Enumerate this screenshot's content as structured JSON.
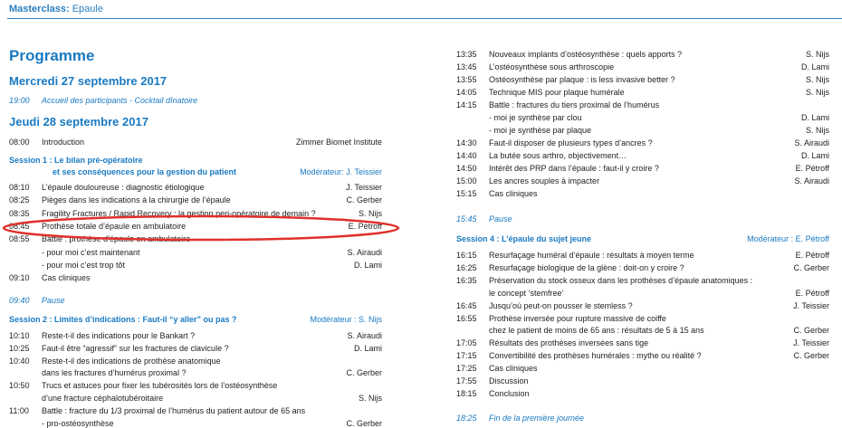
{
  "header": {
    "prefix": "Masterclass:",
    "topic": "Epaule"
  },
  "title": "Programme",
  "left": {
    "day1": "Mercredi 27 septembre 2017",
    "day1_time": "19:00",
    "day1_event": "Accueil des participants - Cocktail dînatoire",
    "day2": "Jeudi 28 septembre 2017",
    "intro": {
      "time": "08:00",
      "title": "Introduction",
      "speaker": "Zimmer Biomet Institute"
    },
    "session1_line1": "Session 1 : Le bilan pré-opératoire",
    "session1_line2": "et ses conséquences pour la gestion du patient",
    "session1_mod": "Modérateur: J. Teissier",
    "s1": [
      {
        "time": "08:10",
        "title": "L’épaule douloureuse : diagnostic étiologique",
        "speaker": "J. Teissier"
      },
      {
        "time": "08:25",
        "title": "Pièges dans les indications à la chirurgie de l’épaule",
        "speaker": "C. Gerber"
      },
      {
        "time": "08:35",
        "title": "Fragility Fractures / Rapid Recovery : la gestion peri-opératoire de demain ?",
        "speaker": "S. Nijs"
      },
      {
        "time": "08:45",
        "title": "Prothèse totale d’épaule en ambulatoire",
        "speaker": "E. Pétroff"
      },
      {
        "time": "08:55",
        "title": "Battle : prothèse d’épaule en ambulatoire",
        "speaker": ""
      },
      {
        "time": "",
        "title": "- pour moi c’est maintenant",
        "speaker": "S. Airaudi"
      },
      {
        "time": "",
        "title": "- pour moi c’est trop tôt",
        "speaker": "D. Lami"
      },
      {
        "time": "09:10",
        "title": "Cas cliniques",
        "speaker": ""
      }
    ],
    "pause_time": "09:40",
    "pause_label": "Pause",
    "session2": "Session 2 : Limites d’indications : Faut-il “y aller” ou pas ?",
    "session2_mod": "Modérateur : S. Nijs",
    "s2": [
      {
        "time": "10:10",
        "title": "Reste-t-il des indications pour le Bankart ?",
        "speaker": "S. Airaudi"
      },
      {
        "time": "10:25",
        "title": "Faut-il être “agressif” sur les fractures de clavicule ?",
        "speaker": "D. Lami"
      },
      {
        "time": "10:40",
        "title": "Reste-t-il des indications de prothèse anatomique",
        "speaker": ""
      },
      {
        "time": "",
        "title": "dans les fractures d’humérus proximal ?",
        "speaker": "C. Gerber"
      },
      {
        "time": "10:50",
        "title": "Trucs et astuces pour fixer les tubérosités lors de l’ostéosynthèse",
        "speaker": ""
      },
      {
        "time": "",
        "title": "d’une fracture céphalotubéroitaire",
        "speaker": "S. Nijs"
      },
      {
        "time": "11:00",
        "title": "Battle : fracture du 1/3 proximal de l’humérus du patient autour de 65 ans",
        "speaker": ""
      },
      {
        "time": "",
        "title": "- pro-ostéosynthèse",
        "speaker": "C. Gerber"
      }
    ]
  },
  "right": {
    "r1": [
      {
        "time": "13:35",
        "title": "Nouveaux implants d’ostéosynthèse : quels apports ?",
        "speaker": "S. Nijs"
      },
      {
        "time": "13:45",
        "title": "L’ostéosynthèse sous arthroscopie",
        "speaker": "D. Lami"
      },
      {
        "time": "13:55",
        "title": "Ostéosynthèse par plaque : is less invasive better ?",
        "speaker": "S. Nijs"
      },
      {
        "time": "14:05",
        "title": "Technique MIS pour plaque humérale",
        "speaker": "S. Nijs"
      },
      {
        "time": "14:15",
        "title": "Battle : fractures du tiers proximal de l’humérus",
        "speaker": ""
      },
      {
        "time": "",
        "title": "- moi je synthèse par clou",
        "speaker": "D. Lami"
      },
      {
        "time": "",
        "title": "- moi je synthèse par plaque",
        "speaker": "S. Nijs"
      },
      {
        "time": "14:30",
        "title": "Faut-il disposer de plusieurs types d’ancres ?",
        "speaker": "S. Airaudi"
      },
      {
        "time": "14:40",
        "title": "La butée sous arthro, objectivement…",
        "speaker": "D. Lami"
      },
      {
        "time": "14:50",
        "title": "Intérêt des PRP dans l’épaule : faut-il y croire ?",
        "speaker": "E. Pétroff"
      },
      {
        "time": "15:00",
        "title": "Les ancres souples à impacter",
        "speaker": "S. Airaudi"
      },
      {
        "time": "15:15",
        "title": "Cas cliniques",
        "speaker": ""
      }
    ],
    "pause_time": "15:45",
    "pause_label": "Pause",
    "session4": "Session 4 : L’épaule du sujet jeune",
    "session4_mod": "Modérateur : E. Pétroff",
    "r2": [
      {
        "time": "16:15",
        "title": "Resurfaçage huméral d’épaule : résultats à moyen terme",
        "speaker": "E. Pétroff"
      },
      {
        "time": "16:25",
        "title": "Resurfaçage biologique de la glène : doit-on y croire ?",
        "speaker": "C. Gerber"
      },
      {
        "time": "16:35",
        "title": "Préservation du stock osseux dans les prothèses d’épaule anatomiques :",
        "speaker": ""
      },
      {
        "time": "",
        "title": "le concept ‘stemfree’",
        "speaker": "E. Pétroff"
      },
      {
        "time": "16:45",
        "title": "Jusqu’où peut-on pousser le stemless ?",
        "speaker": "J. Teissier"
      },
      {
        "time": "16:55",
        "title": "Prothèse inversée pour rupture massive de coiffe",
        "speaker": ""
      },
      {
        "time": "",
        "title": "chez le patient de moins de 65 ans : résultats de 5 à 15 ans",
        "speaker": "C. Gerber"
      },
      {
        "time": "17:05",
        "title": "Résultats des prothèses inversées sans tige",
        "speaker": "J. Teissier"
      },
      {
        "time": "17:15",
        "title": "Convertibilité des prothèses humérales : mythe ou réalité ?",
        "speaker": "C. Gerber"
      },
      {
        "time": "17:25",
        "title": "Cas cliniques",
        "speaker": ""
      },
      {
        "time": "17:55",
        "title": "Discussion",
        "speaker": ""
      },
      {
        "time": "18:15",
        "title": "Conclusion",
        "speaker": ""
      }
    ],
    "end_time": "18:25",
    "end_label": "Fin de la première journée"
  },
  "colors": {
    "accent": "#1a7ac2",
    "highlight": "#e0302a"
  }
}
